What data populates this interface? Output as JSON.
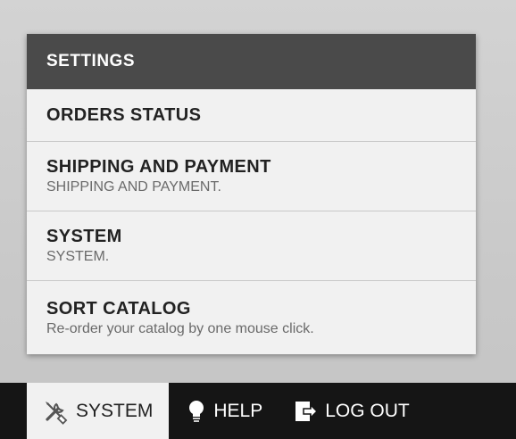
{
  "menu": {
    "header": "SETTINGS",
    "items": [
      {
        "title": "ORDERS STATUS",
        "desc": ""
      },
      {
        "title": "SHIPPING AND PAYMENT",
        "desc": "SHIPPING AND PAYMENT."
      },
      {
        "title": "SYSTEM",
        "desc": "SYSTEM."
      },
      {
        "title": "SORT CATALOG",
        "desc": "Re-order your catalog by one mouse click."
      }
    ]
  },
  "bottom_bar": {
    "system_label": "SYSTEM",
    "help_label": "HELP",
    "logout_label": "LOG OUT",
    "system_icon": "tools-icon",
    "help_icon": "lightbulb-icon",
    "logout_icon": "logout-icon"
  },
  "colors": {
    "header_bg": "#4a4a4a",
    "bar_bg": "#151515",
    "menu_bg": "#f1f1f1"
  }
}
